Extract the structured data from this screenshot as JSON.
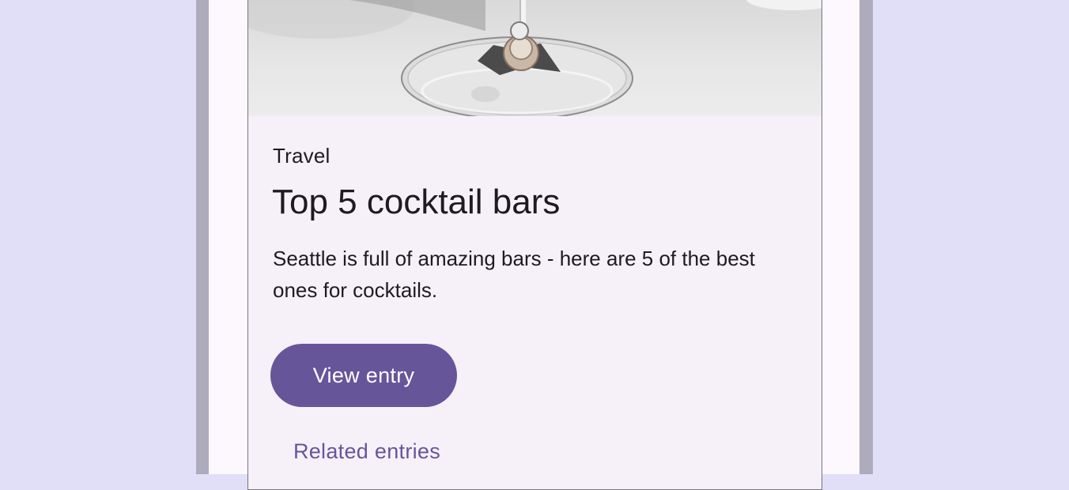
{
  "card": {
    "overline": "Travel",
    "headline": "Top 5 cocktail bars",
    "supporting_text": "Seattle is full of amazing bars - here are 5 of the best ones for cocktails.",
    "primary_action": "View entry",
    "secondary_action": "Related entries"
  },
  "colors": {
    "background": "#e1def7",
    "device_frame": "#aeabbd",
    "screen": "#fdf7fe",
    "card_surface": "#f6f1f9",
    "primary": "#67559a",
    "on_surface": "#1d1b20"
  },
  "icons": {
    "media": "cocktail-glass-photo"
  }
}
